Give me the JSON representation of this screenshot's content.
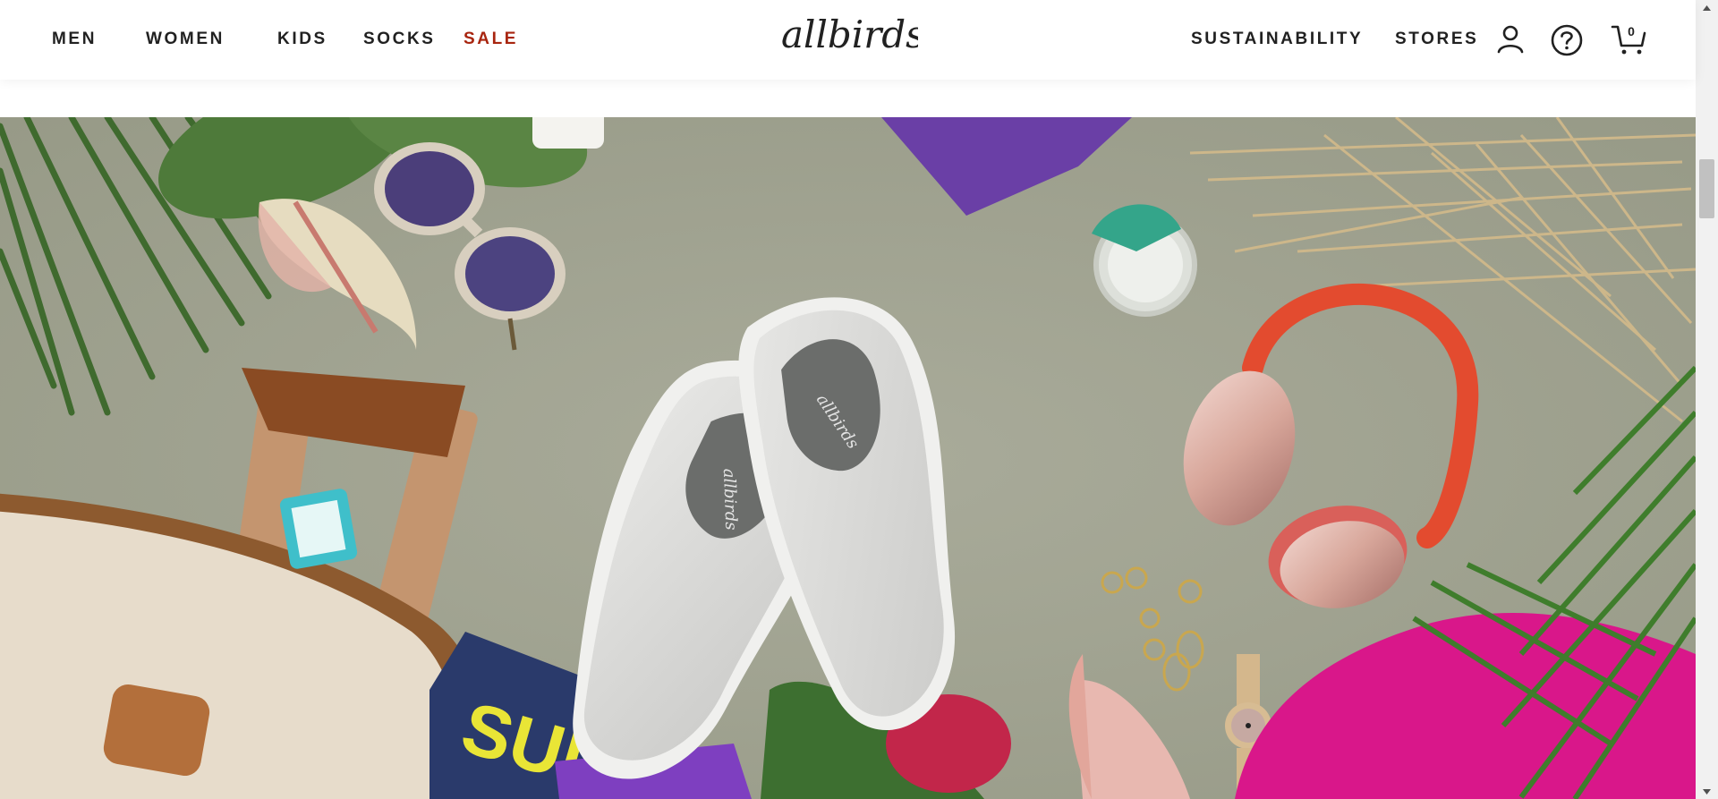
{
  "header": {
    "nav_left": [
      {
        "label": "MEN"
      },
      {
        "label": "WOMEN"
      },
      {
        "label": "KIDS"
      },
      {
        "label": "SOCKS"
      },
      {
        "label": "SALE"
      }
    ],
    "logo_text": "allbirds",
    "nav_right": [
      {
        "label": "SUSTAINABILITY"
      },
      {
        "label": "STORES"
      }
    ],
    "cart_count": "0"
  },
  "hero": {
    "shoe_brand_print": "allbirds",
    "magazine_text": "SUDS"
  },
  "colors": {
    "text": "#212121",
    "sale": "#a8250f",
    "hero_background": "#a3a694"
  },
  "icons": [
    "account-icon",
    "help-icon",
    "cart-icon",
    "scroll-up-icon",
    "scroll-down-icon"
  ]
}
